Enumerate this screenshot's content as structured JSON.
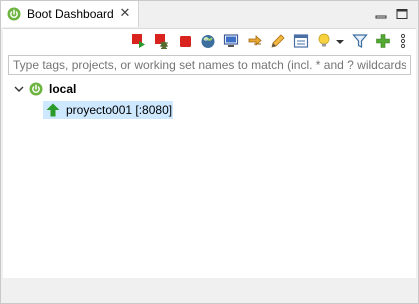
{
  "tab": {
    "title": "Boot Dashboard",
    "icon": "spring-boot-icon",
    "close_label": "✕"
  },
  "window_controls": [
    "minimize-icon",
    "maximize-icon"
  ],
  "toolbar": {
    "buttons": [
      "start-icon",
      "debug-icon",
      "stop-icon",
      "open-browser-icon",
      "open-console-icon",
      "link-icon",
      "edit-icon",
      "properties-icon",
      "tip-icon",
      "dropdown-icon",
      "filter-icon",
      "add-icon",
      "view-menu-icon"
    ]
  },
  "filter": {
    "placeholder": "Type tags, projects, or working set names to match (incl. * and ? wildcards)"
  },
  "tree": {
    "root": {
      "label": "local",
      "expanded": true
    },
    "children": [
      {
        "label": "proyecto001 [:8080]",
        "status": "running",
        "selected": true
      }
    ]
  },
  "colors": {
    "spring_green": "#6db33f",
    "running_green": "#2a9a2a",
    "stop_red": "#d9231f",
    "selection": "#cde8ff"
  }
}
